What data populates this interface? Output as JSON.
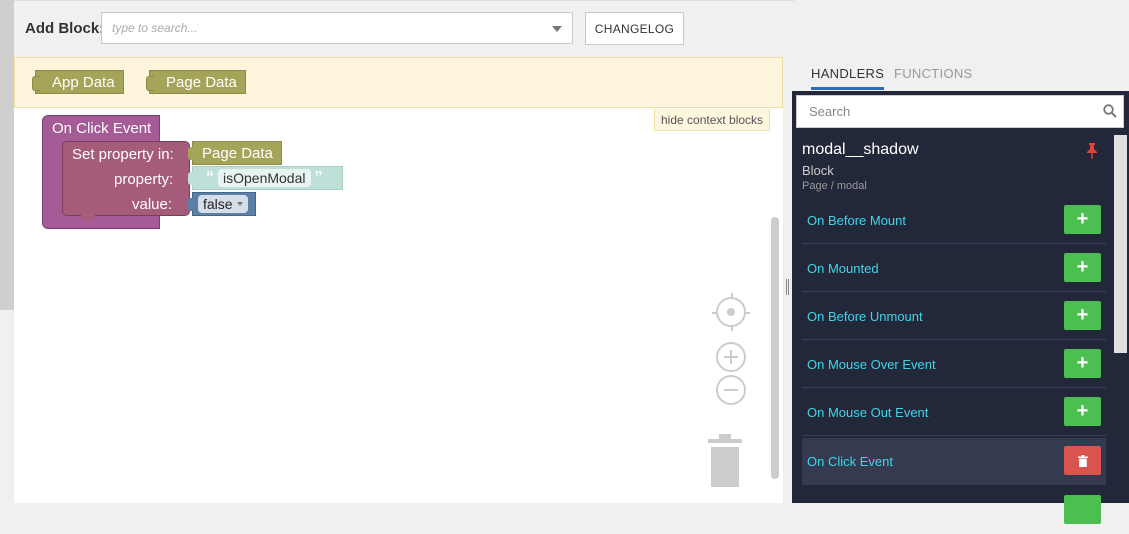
{
  "toolbar": {
    "add_block_label": "Add Block:",
    "search_placeholder": "type to search...",
    "changelog_label": "CHANGELOG"
  },
  "context": {
    "blocks": [
      "App Data",
      "Page Data"
    ],
    "hide_label": "hide context blocks"
  },
  "workspace": {
    "event_title": "On Click Event",
    "set_labels": [
      "Set property in:",
      "property:",
      "value:"
    ],
    "target_value": "Page Data",
    "property_value": "isOpenModal",
    "bool_value": "false"
  },
  "panel": {
    "tabs": [
      "HANDLERS",
      "FUNCTIONS"
    ],
    "active_tab": "HANDLERS",
    "search_placeholder": "Search",
    "block_name": "modal__shadow",
    "block_type": "Block",
    "block_path": "Page / modal",
    "handlers": [
      {
        "label": "On Before Mount",
        "action": "add"
      },
      {
        "label": "On Mounted",
        "action": "add"
      },
      {
        "label": "On Before Unmount",
        "action": "add"
      },
      {
        "label": "On Mouse Over Event",
        "action": "add"
      },
      {
        "label": "On Mouse Out Event",
        "action": "add"
      },
      {
        "label": "On Click Event",
        "action": "delete"
      }
    ]
  },
  "colors": {
    "event_block": "#a55b95",
    "data_block": "#a5a55a",
    "add_button": "#4bbf4f",
    "delete_button": "#d9534f",
    "panel_bg": "#22283a",
    "handler_text": "#3fd6e6"
  }
}
